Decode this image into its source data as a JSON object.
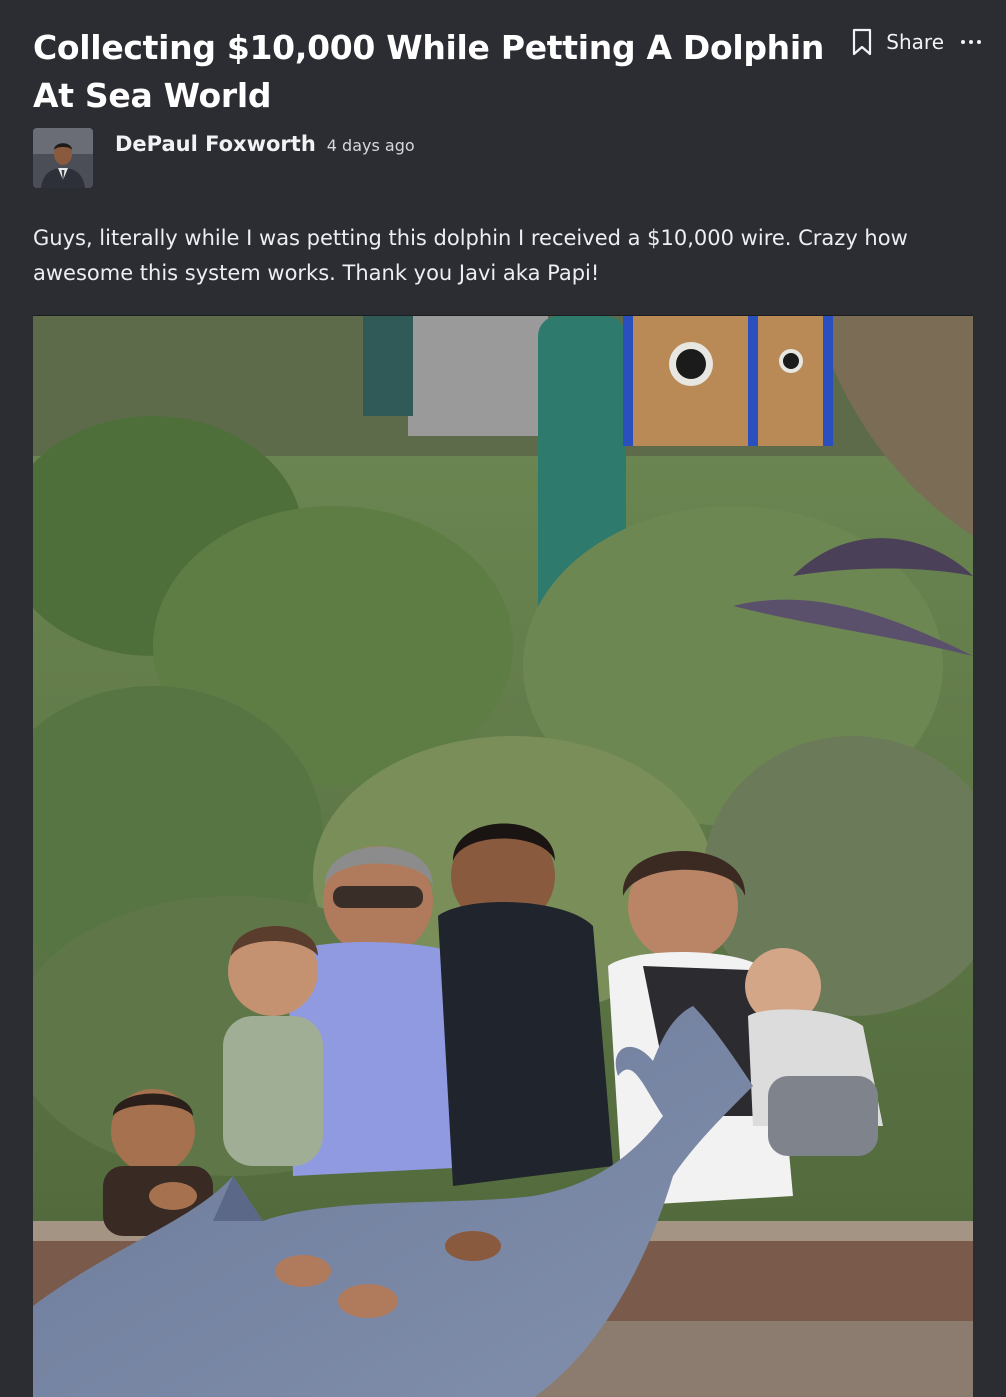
{
  "post": {
    "title": "Collecting $10,000 While Petting A Dolphin At Sea World",
    "actions": {
      "bookmark_icon": "bookmark-icon",
      "share_label": "Share",
      "more_icon": "more-horizontal-icon"
    },
    "author": {
      "name": "DePaul Foxworth",
      "time": "4 days ago"
    },
    "body": "Guys, literally while I was petting this dolphin I received a $10,000 wire. Crazy how awesome this system works. Thank you Javi aka Papi!"
  },
  "colors": {
    "background": "#2b2d33",
    "text": "#f1f2f4"
  }
}
